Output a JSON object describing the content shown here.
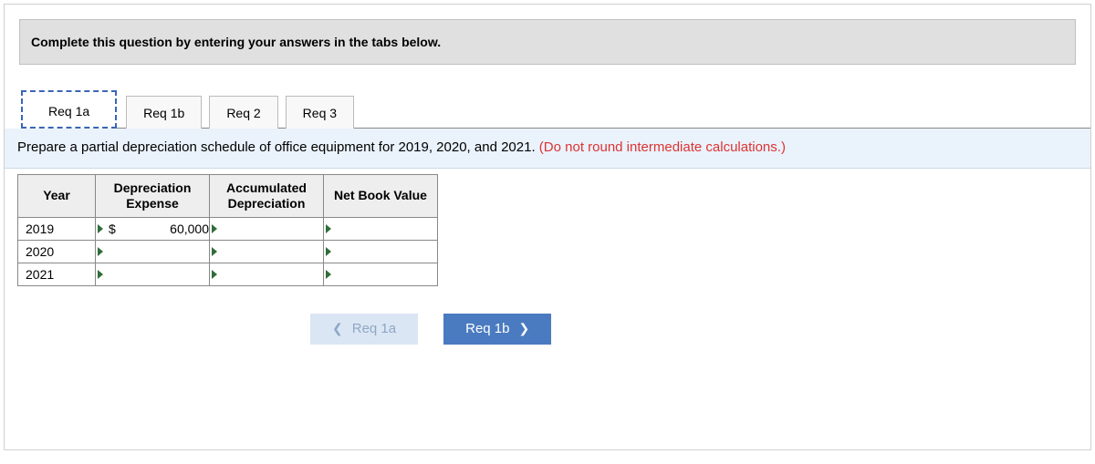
{
  "instruction": "Complete this question by entering your answers in the tabs below.",
  "tabs": [
    {
      "label": "Req 1a"
    },
    {
      "label": "Req 1b"
    },
    {
      "label": "Req 2"
    },
    {
      "label": "Req 3"
    }
  ],
  "prompt": {
    "main": "Prepare a partial depreciation schedule of office equipment for 2019, 2020, and 2021. ",
    "warning": "(Do not round intermediate calculations.)"
  },
  "table": {
    "headers": {
      "year": "Year",
      "dep": "Depreciation Expense",
      "acc": "Accumulated Depreciation",
      "net": "Net Book Value"
    },
    "rows": [
      {
        "year": "2019",
        "currency": "$",
        "dep": "60,000",
        "acc": "",
        "net": ""
      },
      {
        "year": "2020",
        "currency": "",
        "dep": "",
        "acc": "",
        "net": ""
      },
      {
        "year": "2021",
        "currency": "",
        "dep": "",
        "acc": "",
        "net": ""
      }
    ]
  },
  "nav": {
    "prev": "Req 1a",
    "next": "Req 1b"
  }
}
